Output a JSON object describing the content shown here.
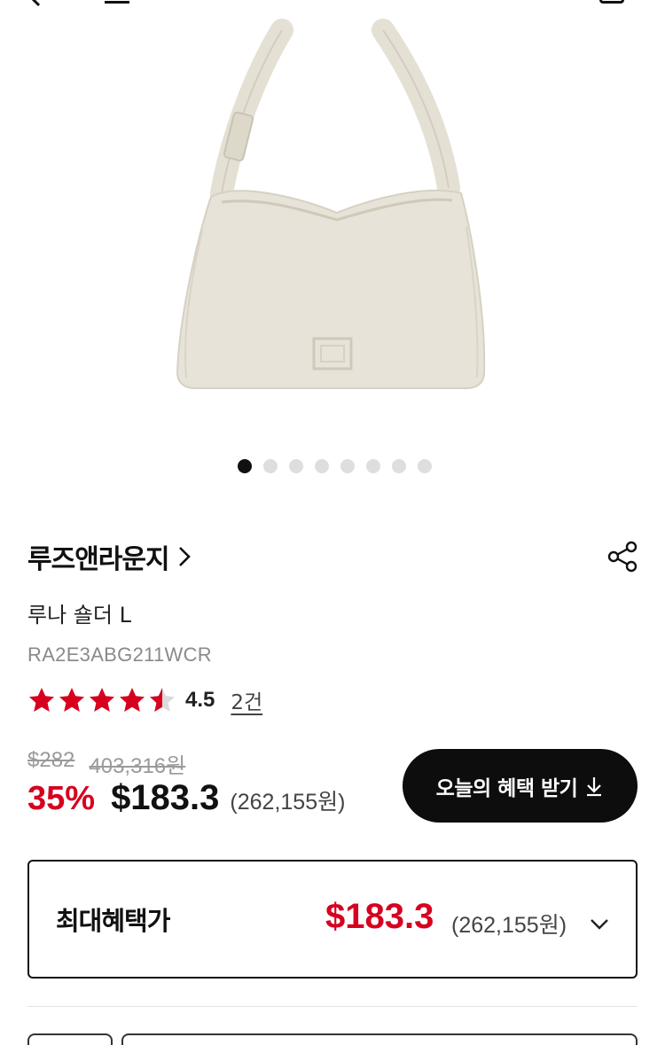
{
  "colors": {
    "accent_red": "#d7001f",
    "text_dark": "#111111",
    "text_muted": "#8a8a8a",
    "dot_inactive": "#dedede",
    "button_bg": "#0d0d0d"
  },
  "header": {
    "back_icon": "chevron-left-icon",
    "home_icon": "home-icon",
    "cart_icon": "shopping-bag-icon"
  },
  "product": {
    "image_subject": "ivory-shoulder-bag",
    "carousel": {
      "total": 8,
      "active_index": 0
    },
    "brand": "루즈앤라운지",
    "name": "루나 숄더 L",
    "code": "RA2E3ABG211WCR",
    "rating": {
      "value": "4.5",
      "stars": 4.5,
      "max": 5,
      "review_count": "2건"
    },
    "original_price_usd": "$282",
    "original_price_krw": "403,316원",
    "discount_rate": "35%",
    "sale_price_usd": "$183.3",
    "sale_price_krw": "(262,155원)"
  },
  "benefit_button": {
    "label": "오늘의 혜택 받기",
    "icon": "download-icon"
  },
  "max_benefit": {
    "label": "최대혜택가",
    "price_usd": "$183.3",
    "price_krw": "(262,155원)",
    "chevron": "chevron-down-icon"
  }
}
